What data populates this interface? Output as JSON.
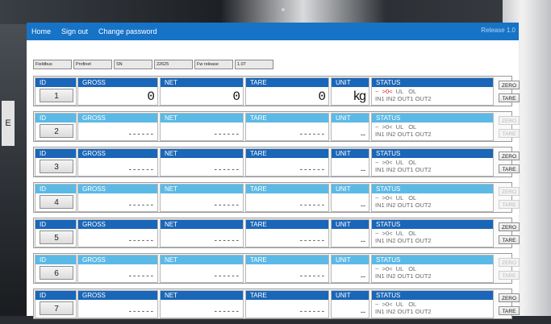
{
  "nav": {
    "home": "Home",
    "signout": "Sign out",
    "changepw": "Change password",
    "version": "Release 1.0"
  },
  "info": [
    {
      "label": "Fieldbus"
    },
    {
      "label": "Profinet"
    },
    {
      "label": "SN"
    },
    {
      "label": "22625"
    },
    {
      "label": "Fw release"
    },
    {
      "label": "1.07"
    }
  ],
  "headers": {
    "id": "ID",
    "gross": "GROSS",
    "net": "NET",
    "tare": "TARE",
    "unit": "UNIT",
    "status": "STATUS"
  },
  "buttons": {
    "zero": "ZERO",
    "tare": "TARE"
  },
  "background": {
    "left_label": "E"
  },
  "status_lines": {
    "line1_a": "~  ",
    "line1_b": ">0<",
    "line1_c": "  UL   OL",
    "line2": "IN1 IN2 OUT1 OUT2"
  },
  "scales": [
    {
      "id": "1",
      "gross": "0",
      "net": "0",
      "tare": "0",
      "unit": "kg",
      "active": true
    },
    {
      "id": "2",
      "gross": "------",
      "net": "------",
      "tare": "------",
      "unit": "--",
      "active": false
    },
    {
      "id": "3",
      "gross": "------",
      "net": "------",
      "tare": "------",
      "unit": "--",
      "active": true
    },
    {
      "id": "4",
      "gross": "------",
      "net": "------",
      "tare": "------",
      "unit": "--",
      "active": false
    },
    {
      "id": "5",
      "gross": "------",
      "net": "------",
      "tare": "------",
      "unit": "--",
      "active": true
    },
    {
      "id": "6",
      "gross": "------",
      "net": "------",
      "tare": "------",
      "unit": "--",
      "active": false
    },
    {
      "id": "7",
      "gross": "------",
      "net": "------",
      "tare": "------",
      "unit": "--",
      "active": true
    }
  ],
  "colors": {
    "header_active": "#1a66b8",
    "header_inactive": "#5bb9e6",
    "topbar": "#1673c6"
  }
}
